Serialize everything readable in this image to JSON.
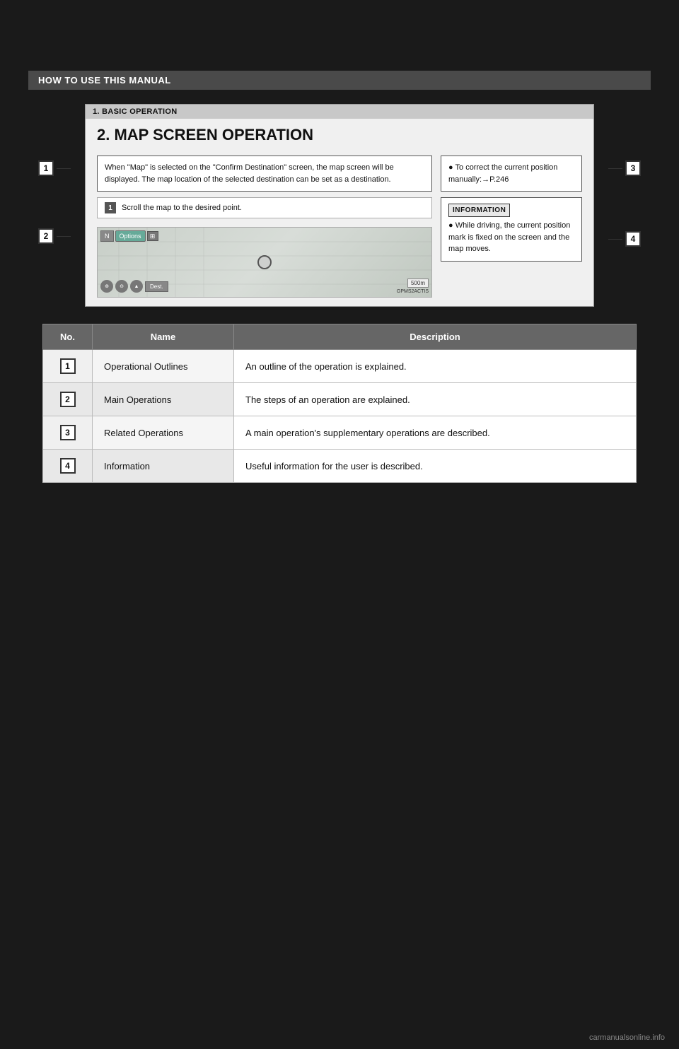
{
  "page": {
    "background_color": "#1a1a1a",
    "watermark": "carmanualsonline.info"
  },
  "section_bar": {
    "text": "HOW TO USE THIS MANUAL"
  },
  "diagram": {
    "inner_header": "1. BASIC OPERATION",
    "title": "2. MAP SCREEN OPERATION",
    "callout1": {
      "text": "When \"Map\" is selected on the \"Confirm Destination\" screen, the map screen will be displayed. The map location of the selected destination can be set as a destination.",
      "label": "1"
    },
    "callout2": {
      "text": "Scroll the map to the desired point.",
      "step_number": "1",
      "label": "2"
    },
    "callout3": {
      "text": "To correct the current position manually:→P.246",
      "label": "3"
    },
    "callout4_header": "INFORMATION",
    "callout4": {
      "text": "While driving, the current position mark is fixed on the screen and the map moves.",
      "label": "4"
    },
    "map": {
      "button_n": "N",
      "button_options": "Options",
      "button_scale": "500m",
      "button_dest": "Dest.",
      "corner_label": "GPMS2ACTIS"
    }
  },
  "table": {
    "headers": [
      "No.",
      "Name",
      "Description"
    ],
    "rows": [
      {
        "no": "1",
        "name": "Operational Outlines",
        "description": "An outline of the operation is explained."
      },
      {
        "no": "2",
        "name": "Main Operations",
        "description": "The steps of an operation are explained."
      },
      {
        "no": "3",
        "name": "Related Operations",
        "description": "A main operation's supplementary operations are described."
      },
      {
        "no": "4",
        "name": "Information",
        "description": "Useful information for the user is described."
      }
    ]
  }
}
